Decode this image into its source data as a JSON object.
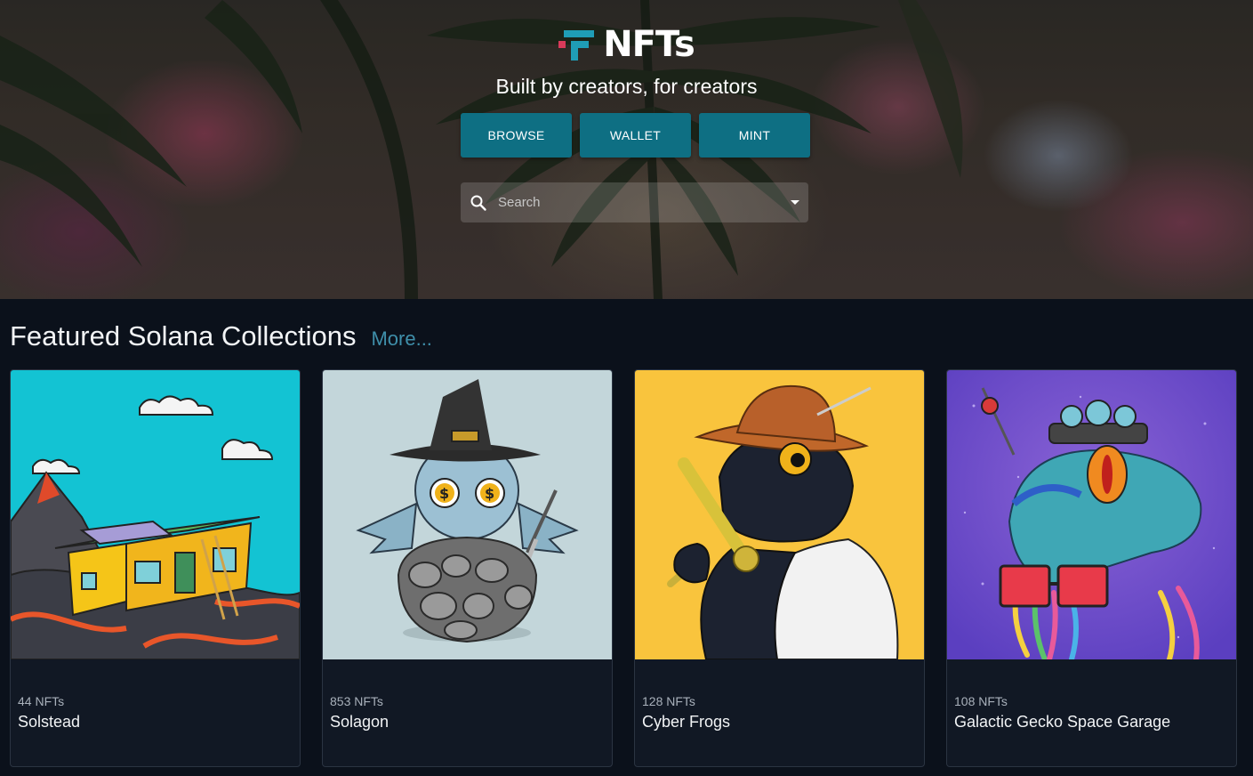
{
  "header": {
    "logo_text": "NFTs",
    "tagline": "Built by creators, for creators",
    "buttons": [
      "BROWSE",
      "WALLET",
      "MINT"
    ],
    "search": {
      "placeholder": "Search",
      "value": ""
    }
  },
  "featured": {
    "title": "Featured Solana Collections",
    "more_label": "More..."
  },
  "collections": [
    {
      "count": "44 NFTs",
      "name": "Solstead"
    },
    {
      "count": "853 NFTs",
      "name": "Solagon"
    },
    {
      "count": "128 NFTs",
      "name": "Cyber Frogs"
    },
    {
      "count": "108 NFTs",
      "name": "Galactic Gecko Space Garage"
    }
  ],
  "colors": {
    "button_bg": "#0e6f83",
    "page_bg": "#0b111b",
    "card_bg": "#111824",
    "link": "#3f8faa"
  },
  "icons": [
    "logo-mark-icon",
    "search-icon",
    "chevron-down-icon"
  ]
}
